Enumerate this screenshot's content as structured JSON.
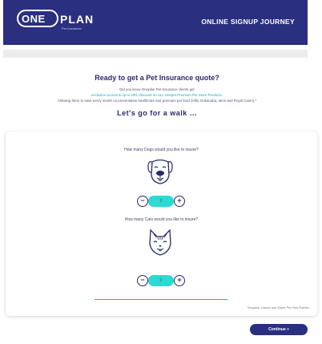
{
  "header": {
    "logo_one": "ONE",
    "logo_plan": "PLAN",
    "logo_sub": "Pet Insurance",
    "title": "ONLINE SIGNUP JOURNEY"
  },
  "intro": {
    "title": "Ready to get a Pet Insurance quote?",
    "line1": "Did you know Oneplan Pet Insurance clients get",
    "line2": "exclusive access & up to 25% discount on ALL Onepet Premium Pet Store Products.",
    "line3": "Allowing them to save every month on preventative healthcare and premium pet food (Hills, Eukanuba, Iams and Royal Canin).*",
    "walk": "Let's go for a walk ..."
  },
  "dogs": {
    "question": "How many Dogs would you like to insure?",
    "value": "0",
    "minus": "−",
    "plus": "+"
  },
  "cats": {
    "question": "How many Cats would you like to insure?",
    "value": "0",
    "minus": "−",
    "plus": "+"
  },
  "footnote": "*Hospital, Classic and Super Pet Plan Policies",
  "continue_label": "Continue »",
  "colors": {
    "brand": "#2b2f7f",
    "accent": "#2bdbd0",
    "link": "#18a8c8"
  }
}
